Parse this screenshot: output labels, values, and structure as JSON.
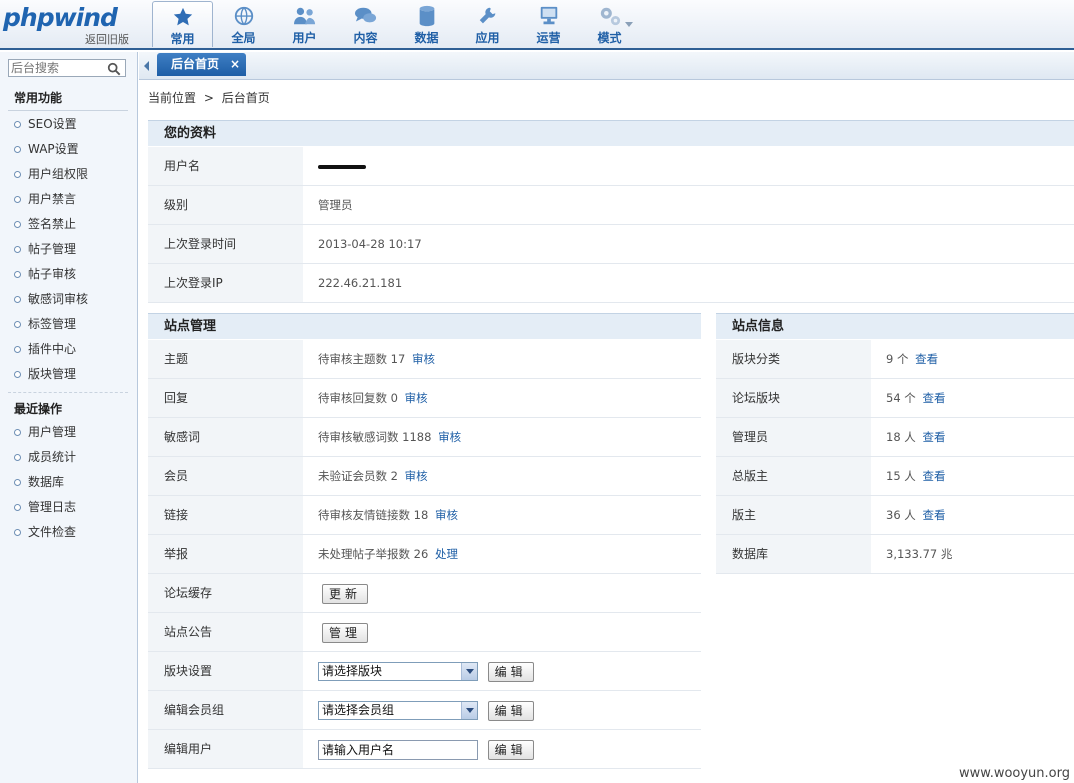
{
  "header": {
    "logo_text": "phpwind",
    "old_version_link": "返回旧版",
    "nav": [
      {
        "label": "常用",
        "icon": "star-icon",
        "active": true
      },
      {
        "label": "全局",
        "icon": "globe-icon"
      },
      {
        "label": "用户",
        "icon": "users-icon"
      },
      {
        "label": "内容",
        "icon": "chat-bubbles-icon"
      },
      {
        "label": "数据",
        "icon": "database-icon"
      },
      {
        "label": "应用",
        "icon": "wrench-icon"
      },
      {
        "label": "运营",
        "icon": "monitor-icon"
      },
      {
        "label": "模式",
        "icon": "gears-icon"
      }
    ]
  },
  "sidebar": {
    "search_placeholder": "后台搜索",
    "section_common": "常用功能",
    "common_items": [
      "SEO设置",
      "WAP设置",
      "用户组权限",
      "用户禁言",
      "签名禁止",
      "帖子管理",
      "帖子审核",
      "敏感词审核",
      "标签管理",
      "插件中心",
      "版块管理"
    ],
    "section_recent": "最近操作",
    "recent_items": [
      "用户管理",
      "成员统计",
      "数据库",
      "管理日志",
      "文件检查"
    ]
  },
  "tabs": {
    "active_tab": "后台首页",
    "close_symbol": "×"
  },
  "breadcrumb": {
    "prefix": "当前位置",
    "separator": ">",
    "current": "后台首页"
  },
  "profile": {
    "title": "您的资料",
    "rows": [
      {
        "label": "用户名",
        "value": ""
      },
      {
        "label": "级别",
        "value": "管理员"
      },
      {
        "label": "上次登录时间",
        "value": "2013-04-28 10:17"
      },
      {
        "label": "上次登录IP",
        "value": "222.46.21.181"
      }
    ]
  },
  "site_manage": {
    "title": "站点管理",
    "rows": [
      {
        "label": "主题",
        "value": "待审核主题数 17",
        "action": "审核"
      },
      {
        "label": "回复",
        "value": "待审核回复数 0",
        "action": "审核"
      },
      {
        "label": "敏感词",
        "value": "待审核敏感词数 1188",
        "action": "审核"
      },
      {
        "label": "会员",
        "value": "未验证会员数 2",
        "action": "审核"
      },
      {
        "label": "链接",
        "value": "待审核友情链接数 18",
        "action": "审核"
      },
      {
        "label": "举报",
        "value": "未处理帖子举报数 26",
        "action": "处理"
      }
    ],
    "cache_label": "论坛缓存",
    "cache_button": "更新",
    "notice_label": "站点公告",
    "notice_button": "管理",
    "forum_setting_label": "版块设置",
    "forum_select": "请选择版块",
    "group_label": "编辑会员组",
    "group_select": "请选择会员组",
    "user_label": "编辑用户",
    "user_placeholder": "请输入用户名",
    "edit_button": "编辑"
  },
  "site_info": {
    "title": "站点信息",
    "rows": [
      {
        "label": "版块分类",
        "value": "9 个",
        "action": "查看"
      },
      {
        "label": "论坛版块",
        "value": "54 个",
        "action": "查看"
      },
      {
        "label": "管理员",
        "value": "18 人",
        "action": "查看"
      },
      {
        "label": "总版主",
        "value": "15 人",
        "action": "查看"
      },
      {
        "label": "版主",
        "value": "36 人",
        "action": "查看"
      },
      {
        "label": "数据库",
        "value": "3,133.77 兆",
        "action": ""
      }
    ]
  },
  "watermark": "www.wooyun.org"
}
